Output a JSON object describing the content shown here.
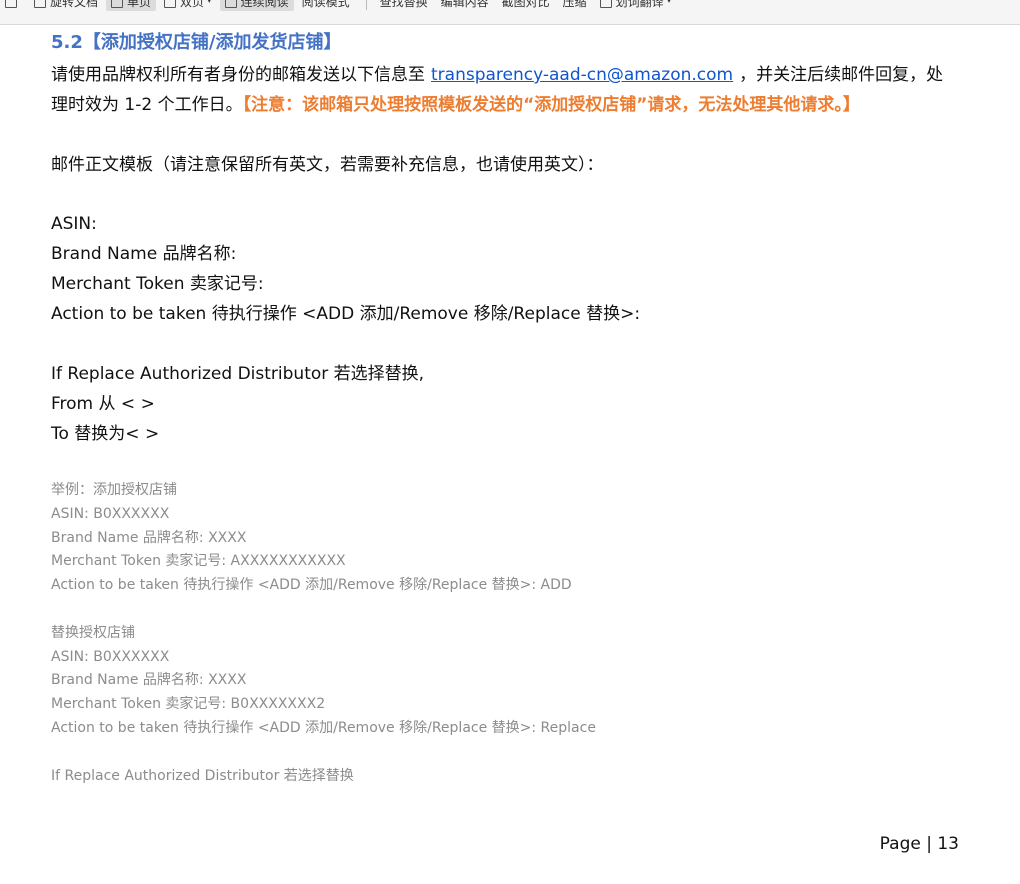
{
  "toolbar": {
    "items": [
      "旋转文档",
      "单页",
      "双页",
      "连续阅读",
      "阅读模式",
      "查找替换",
      "编辑内容",
      "截图对比",
      "压缩",
      "划词翻译"
    ]
  },
  "section": {
    "heading": "5.2【添加授权店铺/添加发货店铺】",
    "intro_prefix": "请使用品牌权利所有者身份的邮箱发送以下信息至",
    "email": "transparency-aad-cn@amazon.com",
    "intro_suffix": "，并关注后续邮件回复，处理时效为 1-2 个工作日。",
    "note": "【注意：该邮箱只处理按照模板发送的“添加授权店铺”请求，无法处理其他请求。】",
    "template_title": "邮件正文模板（请注意保留所有英文，若需要补充信息，也请使用英文）："
  },
  "template": {
    "asin": "ASIN:",
    "brand": "Brand Name 品牌名称:",
    "merchant": "Merchant Token 卖家记号:",
    "action": "Action to be taken 待执行操作 <ADD 添加/Remove 移除/Replace 替换>:",
    "replace_line": "If Replace Authorized Distributor 若选择替换,",
    "from_line": "From 从 < >",
    "to_line": "To 替换为< >"
  },
  "example1": {
    "title": "举例：添加授权店铺",
    "asin": "ASIN: B0XXXXXX",
    "brand": "Brand Name 品牌名称: XXXX",
    "merchant": "Merchant Token 卖家记号: AXXXXXXXXXXX",
    "action": "Action to be taken 待执行操作 <ADD 添加/Remove 移除/Replace 替换>: ADD"
  },
  "example2": {
    "title": "替换授权店铺",
    "asin": "ASIN: B0XXXXXX",
    "brand": "Brand Name 品牌名称: XXXX",
    "merchant": "Merchant Token 卖家记号: B0XXXXXXX2",
    "action": "Action to be taken 待执行操作 <ADD 添加/Remove 移除/Replace 替换>: Replace",
    "replace_line": "If Replace Authorized Distributor 若选择替换"
  },
  "footer": {
    "page": "Page | 13"
  }
}
